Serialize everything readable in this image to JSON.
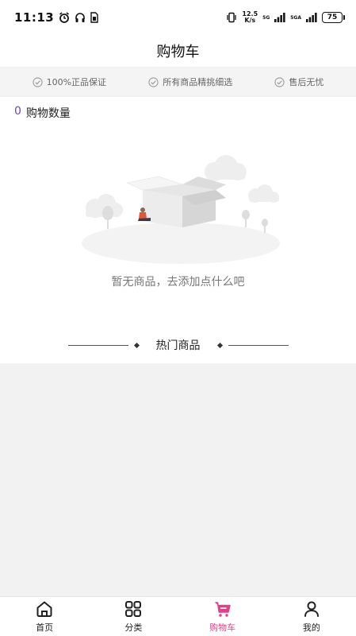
{
  "status_bar": {
    "time": "11:13",
    "net_speed_value": "12.5",
    "net_speed_unit": "K/s",
    "signal1_label": "5G",
    "signal2_label": "5GA",
    "battery": "75"
  },
  "header": {
    "title": "购物车"
  },
  "assurances": [
    {
      "label": "100%正品保证"
    },
    {
      "label": "所有商品精挑细选"
    },
    {
      "label": "售后无忧"
    }
  ],
  "cart": {
    "count": "0",
    "count_label": "购物数量",
    "empty_text": "暂无商品，去添加点什么吧"
  },
  "hot": {
    "title": "热门商品"
  },
  "bottom_nav": {
    "items": [
      {
        "label": "首页",
        "icon": "home-icon"
      },
      {
        "label": "分类",
        "icon": "category-icon"
      },
      {
        "label": "购物车",
        "icon": "cart-icon",
        "active": true
      },
      {
        "label": "我的",
        "icon": "user-icon"
      }
    ]
  },
  "colors": {
    "accent": "#e0408a",
    "count": "#6a4aa3"
  }
}
